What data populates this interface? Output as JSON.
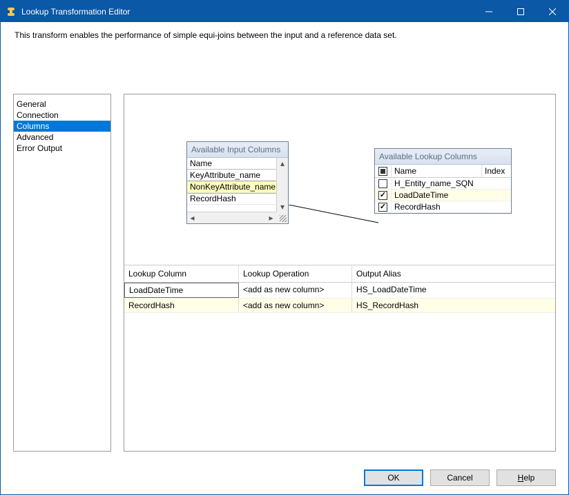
{
  "titlebar": {
    "title": "Lookup Transformation Editor"
  },
  "description": "This transform enables the performance of simple equi-joins between the input and a reference data set.",
  "sidebar": {
    "items": [
      {
        "label": "General"
      },
      {
        "label": "Connection"
      },
      {
        "label": "Columns"
      },
      {
        "label": "Advanced"
      },
      {
        "label": "Error Output"
      }
    ],
    "selected_index": 2
  },
  "available_input": {
    "title": "Available Input Columns",
    "header": "Name",
    "rows": [
      {
        "label": "KeyAttribute_name"
      },
      {
        "label": "NonKeyAttribute_name"
      },
      {
        "label": "RecordHash"
      }
    ],
    "selected_index": 1
  },
  "available_lookup": {
    "title": "Available Lookup Columns",
    "name_header": "Name",
    "index_header": "Index",
    "rows": [
      {
        "label": "H_Entity_name_SQN",
        "checked": false
      },
      {
        "label": "LoadDateTime",
        "checked": true
      },
      {
        "label": "RecordHash",
        "checked": true
      }
    ],
    "selected_index": 1
  },
  "grid": {
    "headers": {
      "col1": "Lookup Column",
      "col2": "Lookup Operation",
      "col3": "Output Alias"
    },
    "rows": [
      {
        "col1": "LoadDateTime",
        "col2": "<add as new column>",
        "col3": "HS_LoadDateTime"
      },
      {
        "col1": "RecordHash",
        "col2": "<add as new column>",
        "col3": "HS_RecordHash"
      }
    ]
  },
  "buttons": {
    "ok": "OK",
    "cancel": "Cancel",
    "help_prefix": "H",
    "help_rest": "elp"
  }
}
